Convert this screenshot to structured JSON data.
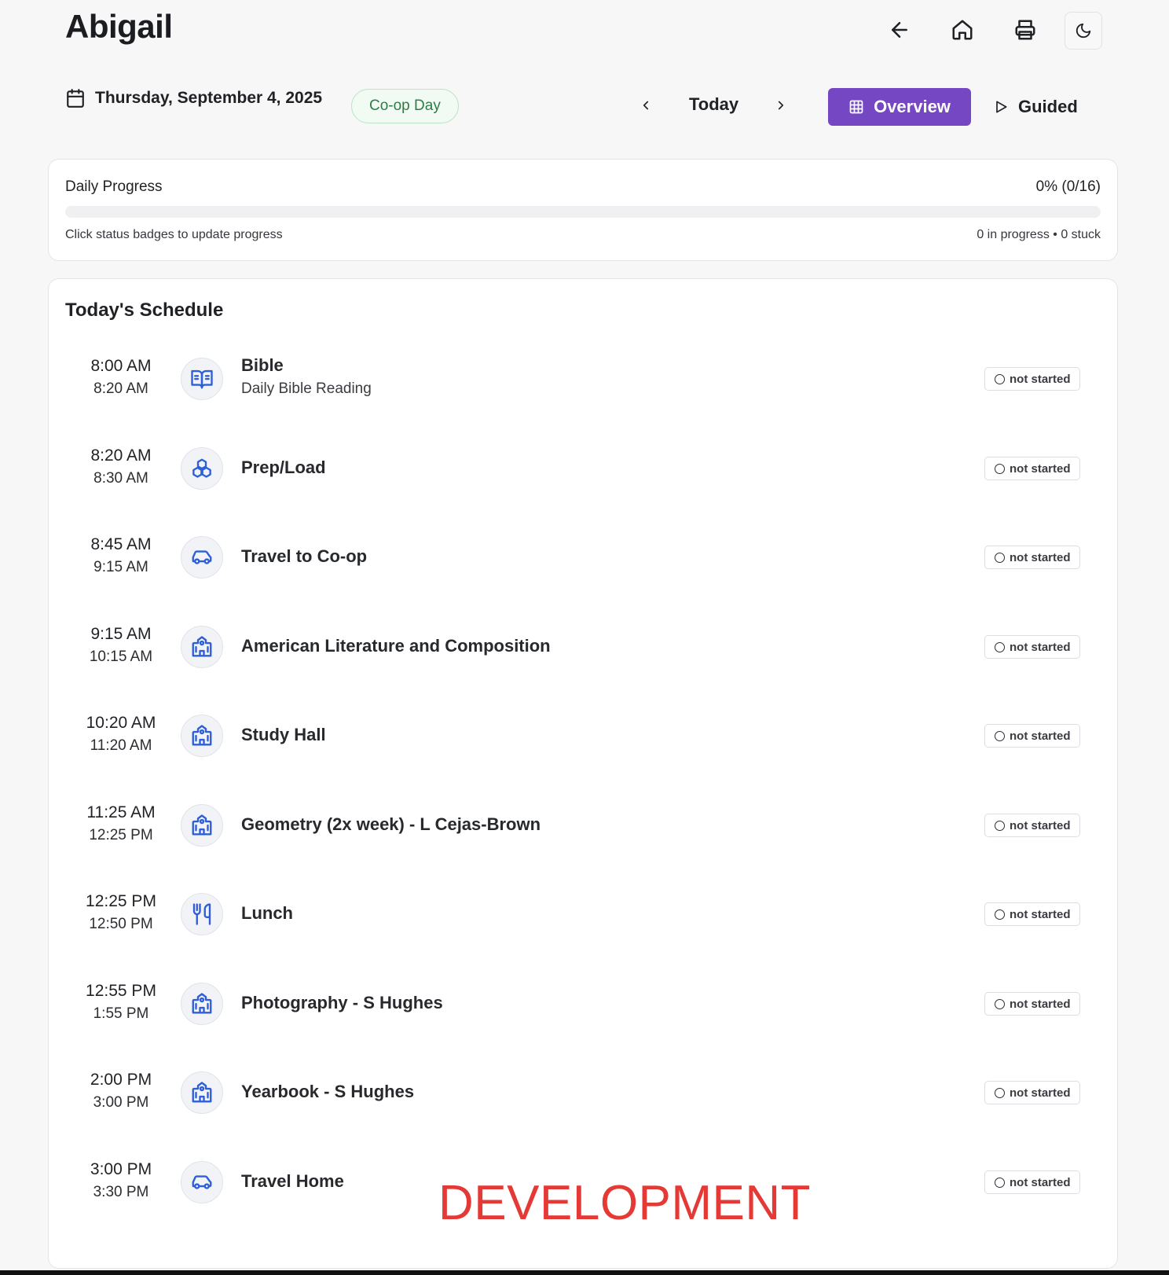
{
  "header": {
    "title": "Abigail",
    "icons": [
      "arrow-left-icon",
      "home-icon",
      "printer-icon",
      "moon-icon"
    ]
  },
  "datebar": {
    "date": "Thursday, September 4, 2025",
    "day_badge": "Co-op Day",
    "today_label": "Today",
    "overview_label": "Overview",
    "guided_label": "Guided"
  },
  "progress": {
    "label": "Daily Progress",
    "percent_text": "0% (0/16)",
    "fill_fraction": 0,
    "hint": "Click status badges to update progress",
    "stats": "0 in progress • 0 stuck"
  },
  "schedule": {
    "title": "Today's Schedule",
    "items": [
      {
        "start": "8:00 AM",
        "end": "8:20 AM",
        "icon": "book-open-icon",
        "title": "Bible",
        "subtitle": "Daily Bible Reading",
        "status": "not started"
      },
      {
        "start": "8:20 AM",
        "end": "8:30 AM",
        "icon": "boxes-icon",
        "title": "Prep/Load",
        "subtitle": "",
        "status": "not started"
      },
      {
        "start": "8:45 AM",
        "end": "9:15 AM",
        "icon": "car-icon",
        "title": "Travel to Co-op",
        "subtitle": "",
        "status": "not started"
      },
      {
        "start": "9:15 AM",
        "end": "10:15 AM",
        "icon": "school-icon",
        "title": "American Literature and Composition",
        "subtitle": "",
        "status": "not started"
      },
      {
        "start": "10:20 AM",
        "end": "11:20 AM",
        "icon": "school-icon",
        "title": "Study Hall",
        "subtitle": "",
        "status": "not started"
      },
      {
        "start": "11:25 AM",
        "end": "12:25 PM",
        "icon": "school-icon",
        "title": "Geometry (2x week) - L Cejas-Brown",
        "subtitle": "",
        "status": "not started"
      },
      {
        "start": "12:25 PM",
        "end": "12:50 PM",
        "icon": "utensils-icon",
        "title": "Lunch",
        "subtitle": "",
        "status": "not started"
      },
      {
        "start": "12:55 PM",
        "end": "1:55 PM",
        "icon": "school-icon",
        "title": "Photography - S Hughes",
        "subtitle": "",
        "status": "not started"
      },
      {
        "start": "2:00 PM",
        "end": "3:00 PM",
        "icon": "school-icon",
        "title": "Yearbook - S Hughes",
        "subtitle": "",
        "status": "not started"
      },
      {
        "start": "3:00 PM",
        "end": "3:30 PM",
        "icon": "car-icon",
        "title": "Travel Home",
        "subtitle": "",
        "status": "not started"
      }
    ]
  },
  "watermark": "DEVELOPMENT",
  "colors": {
    "accent": "#7547c3",
    "icon_blue": "#2e5fd8",
    "badge_green": "#2d7d46",
    "watermark_red": "#e53935"
  }
}
